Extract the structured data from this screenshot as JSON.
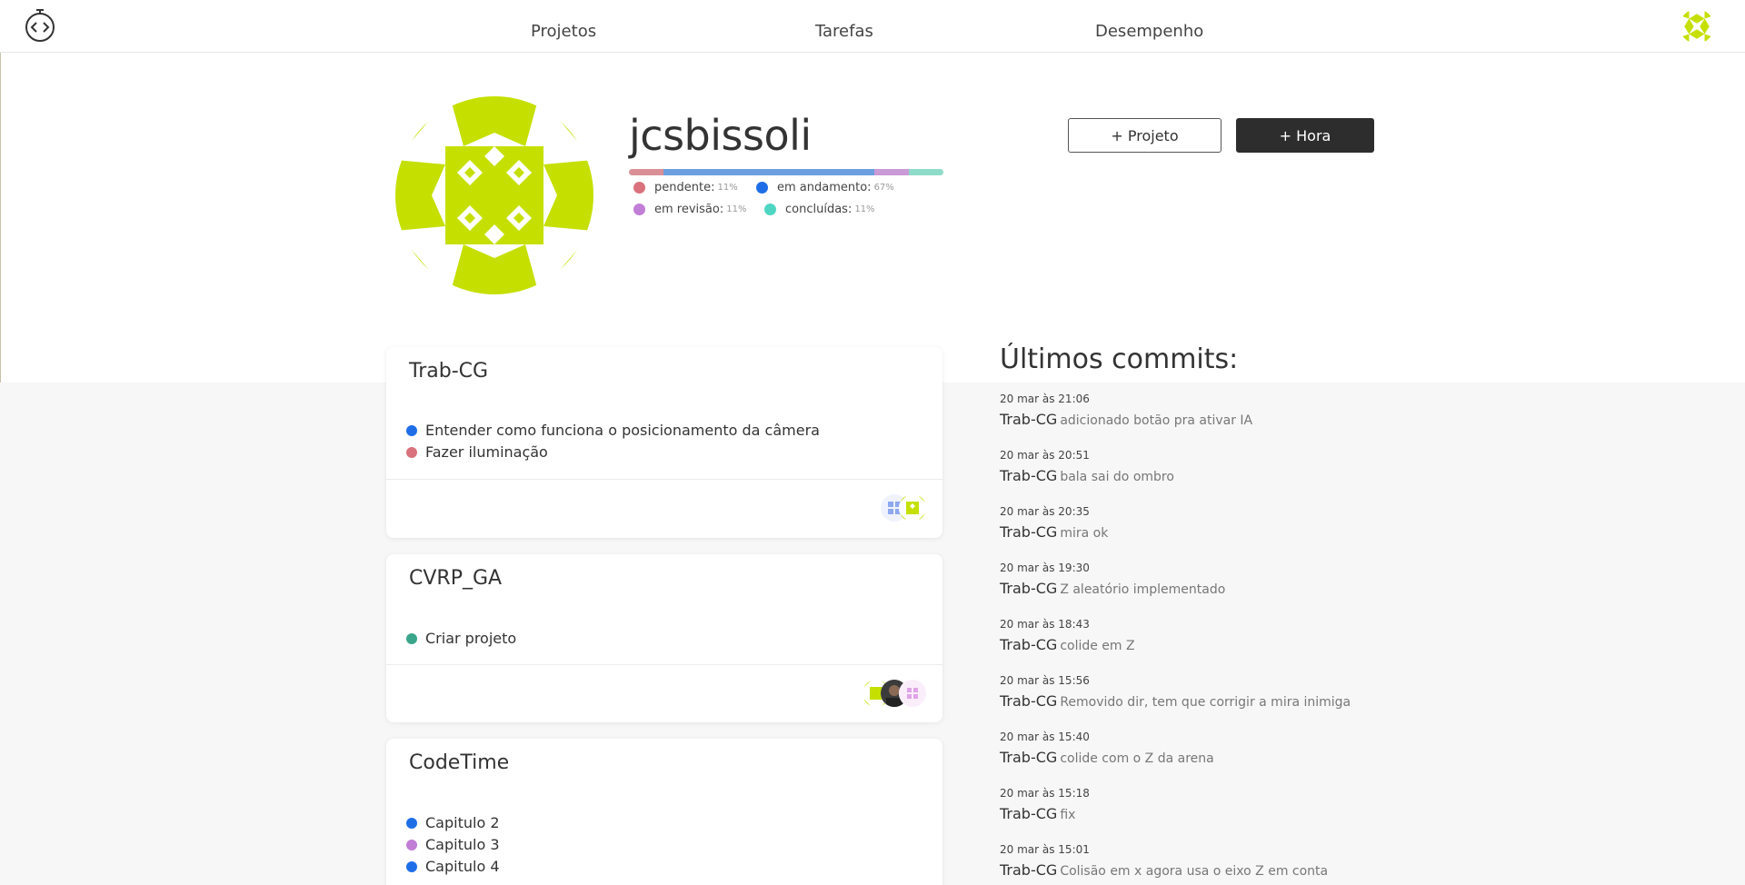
{
  "nav": {
    "items": [
      "Projetos",
      "Tarefas",
      "Desempenho"
    ]
  },
  "profile": {
    "username": "jcsbissoli",
    "status": [
      {
        "label": "pendente:",
        "pct": "11%",
        "color": "#d9727c"
      },
      {
        "label": "em andamento:",
        "pct": "67%",
        "color": "#1f6ee8"
      },
      {
        "label": "em revisão:",
        "pct": "11%",
        "color": "#c17ed6"
      },
      {
        "label": "concluídas:",
        "pct": "11%",
        "color": "#4fd6c2"
      }
    ]
  },
  "actions": {
    "projeto_label": "+ Projeto",
    "hora_label": "+ Hora"
  },
  "projects": [
    {
      "name": "Trab-CG",
      "tasks": [
        {
          "text": "Entender como funciona o posicionamento da câmera",
          "color": "#1f6ee8"
        },
        {
          "text": "Fazer iluminação",
          "color": "#d9727c"
        }
      ]
    },
    {
      "name": "CVRP_GA",
      "tasks": [
        {
          "text": "Criar projeto",
          "color": "#3aa58a"
        }
      ]
    },
    {
      "name": "CodeTime",
      "tasks": [
        {
          "text": "Capitulo 2",
          "color": "#1f6ee8"
        },
        {
          "text": "Capitulo 3",
          "color": "#c17ed6"
        },
        {
          "text": "Capitulo 4",
          "color": "#1f6ee8"
        }
      ]
    }
  ],
  "commits": {
    "title": "Últimos commits:",
    "items": [
      {
        "date": "20 mar às 21:06",
        "project": "Trab-CG",
        "message": "adicionado botão pra ativar IA"
      },
      {
        "date": "20 mar às 20:51",
        "project": "Trab-CG",
        "message": "bala sai do ombro"
      },
      {
        "date": "20 mar às 20:35",
        "project": "Trab-CG",
        "message": "mira ok"
      },
      {
        "date": "20 mar às 19:30",
        "project": "Trab-CG",
        "message": "Z aleatório implementado"
      },
      {
        "date": "20 mar às 18:43",
        "project": "Trab-CG",
        "message": "colide em Z"
      },
      {
        "date": "20 mar às 15:56",
        "project": "Trab-CG",
        "message": "Removido dir, tem que corrigir a mira inimiga"
      },
      {
        "date": "20 mar às 15:40",
        "project": "Trab-CG",
        "message": "colide com o Z da arena"
      },
      {
        "date": "20 mar às 15:18",
        "project": "Trab-CG",
        "message": "fix"
      },
      {
        "date": "20 mar às 15:01",
        "project": "Trab-CG",
        "message": "Colisão em x agora usa o eixo Z em conta"
      }
    ]
  },
  "colors": {
    "accent": "#c5e000",
    "button_dark": "#2d2d2d"
  }
}
